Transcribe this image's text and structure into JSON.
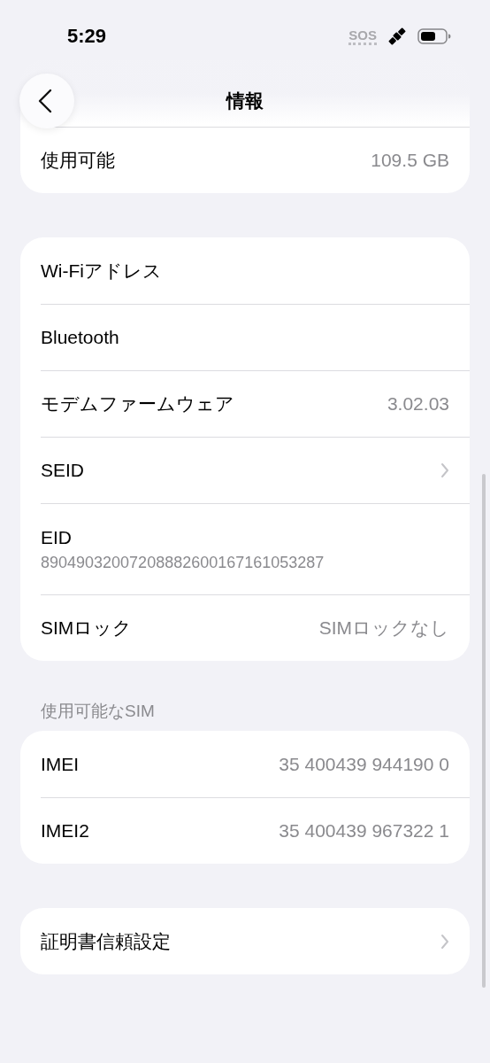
{
  "status_bar": {
    "time": "5:29",
    "sos": "SOS"
  },
  "nav": {
    "title": "情報"
  },
  "groups": [
    {
      "rows": [
        {
          "kind": "value",
          "label": "使用可能",
          "value": "109.5 GB"
        }
      ]
    },
    {
      "rows": [
        {
          "kind": "value",
          "label": "Wi-Fiアドレス"
        },
        {
          "kind": "value",
          "label": "Bluetooth"
        },
        {
          "kind": "value",
          "label": "モデムファームウェア",
          "value": "3.02.03"
        },
        {
          "kind": "chevron",
          "label": "SEID"
        },
        {
          "kind": "stacked",
          "label": "EID",
          "value": "89049032007208882600167161053287"
        },
        {
          "kind": "value",
          "label": "SIMロック",
          "value": "SIMロックなし"
        }
      ]
    },
    {
      "header": "使用可能なSIM",
      "rows": [
        {
          "kind": "value",
          "label": "IMEI",
          "value": "35 400439 944190 0"
        },
        {
          "kind": "value",
          "label": "IMEI2",
          "value": "35 400439 967322 1"
        }
      ]
    },
    {
      "rows": [
        {
          "kind": "chevron",
          "label": "証明書信頼設定"
        }
      ]
    }
  ]
}
